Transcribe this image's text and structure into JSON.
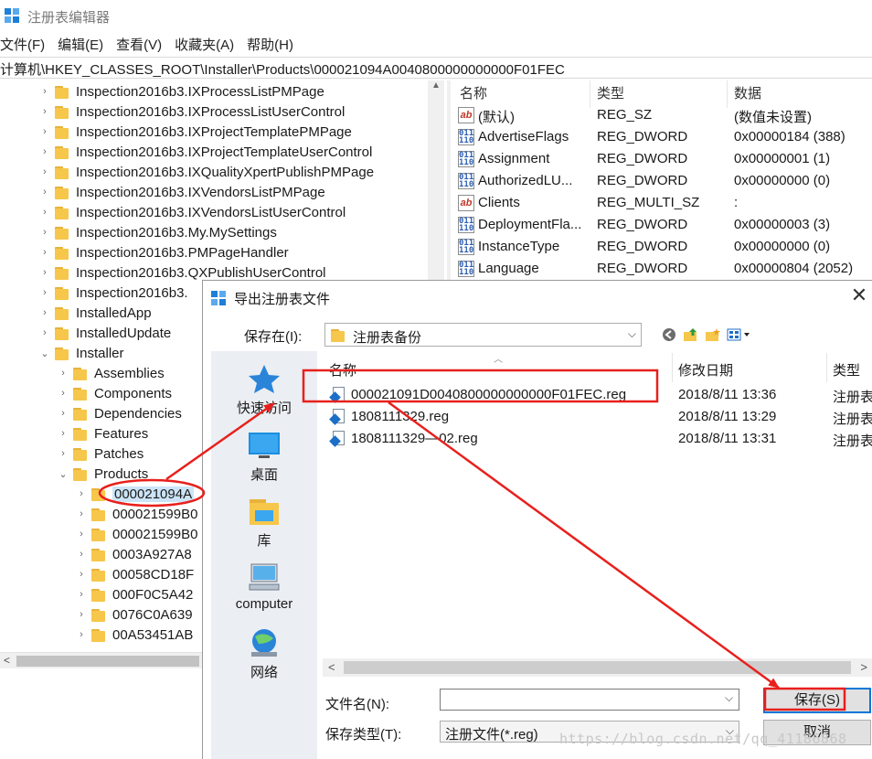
{
  "regedit": {
    "title": "注册表编辑器",
    "menu": [
      "文件(F)",
      "编辑(E)",
      "查看(V)",
      "收藏夹(A)",
      "帮助(H)"
    ],
    "address": "计算机\\HKEY_CLASSES_ROOT\\Installer\\Products\\000021094A0040800000000000F01FEC",
    "tree": [
      {
        "label": "Inspection2016b3.IXProcessListPMPage",
        "level": 1,
        "expanded": false
      },
      {
        "label": "Inspection2016b3.IXProcessListUserControl",
        "level": 1,
        "expanded": false
      },
      {
        "label": "Inspection2016b3.IXProjectTemplatePMPage",
        "level": 1,
        "expanded": false
      },
      {
        "label": "Inspection2016b3.IXProjectTemplateUserControl",
        "level": 1,
        "expanded": false
      },
      {
        "label": "Inspection2016b3.IXQualityXpertPublishPMPage",
        "level": 1,
        "expanded": false
      },
      {
        "label": "Inspection2016b3.IXVendorsListPMPage",
        "level": 1,
        "expanded": false
      },
      {
        "label": "Inspection2016b3.IXVendorsListUserControl",
        "level": 1,
        "expanded": false
      },
      {
        "label": "Inspection2016b3.My.MySettings",
        "level": 1,
        "expanded": false
      },
      {
        "label": "Inspection2016b3.PMPageHandler",
        "level": 1,
        "expanded": false
      },
      {
        "label": "Inspection2016b3.QXPublishUserControl",
        "level": 1,
        "expanded": false
      },
      {
        "label": "Inspection2016b3.",
        "level": 1,
        "expanded": false
      },
      {
        "label": "InstalledApp",
        "level": 1,
        "expanded": false
      },
      {
        "label": "InstalledUpdate",
        "level": 1,
        "expanded": false
      },
      {
        "label": "Installer",
        "level": 1,
        "expanded": true
      },
      {
        "label": "Assemblies",
        "level": 2,
        "expanded": false
      },
      {
        "label": "Components",
        "level": 2,
        "expanded": false
      },
      {
        "label": "Dependencies",
        "level": 2,
        "expanded": false
      },
      {
        "label": "Features",
        "level": 2,
        "expanded": false
      },
      {
        "label": "Patches",
        "level": 2,
        "expanded": false
      },
      {
        "label": "Products",
        "level": 2,
        "expanded": true
      },
      {
        "label": "000021094A",
        "level": 3,
        "expanded": false,
        "selected": true
      },
      {
        "label": "000021599B0",
        "level": 3,
        "expanded": false
      },
      {
        "label": "000021599B0",
        "level": 3,
        "expanded": false
      },
      {
        "label": "0003A927A8",
        "level": 3,
        "expanded": false
      },
      {
        "label": "00058CD18F",
        "level": 3,
        "expanded": false
      },
      {
        "label": "000F0C5A42",
        "level": 3,
        "expanded": false
      },
      {
        "label": "0076C0A639",
        "level": 3,
        "expanded": false
      },
      {
        "label": "00A53451AB",
        "level": 3,
        "expanded": false
      }
    ],
    "values_headers": {
      "name": "名称",
      "type": "类型",
      "data": "数据"
    },
    "values": [
      {
        "icon": "string-value-icon",
        "name": "(默认)",
        "type": "REG_SZ",
        "data": "(数值未设置)"
      },
      {
        "icon": "binary-value-icon",
        "name": "AdvertiseFlags",
        "type": "REG_DWORD",
        "data": "0x00000184 (388)"
      },
      {
        "icon": "binary-value-icon",
        "name": "Assignment",
        "type": "REG_DWORD",
        "data": "0x00000001 (1)"
      },
      {
        "icon": "binary-value-icon",
        "name": "AuthorizedLU...",
        "type": "REG_DWORD",
        "data": "0x00000000 (0)"
      },
      {
        "icon": "string-value-icon",
        "name": "Clients",
        "type": "REG_MULTI_SZ",
        "data": ":"
      },
      {
        "icon": "binary-value-icon",
        "name": "DeploymentFla...",
        "type": "REG_DWORD",
        "data": "0x00000003 (3)"
      },
      {
        "icon": "binary-value-icon",
        "name": "InstanceType",
        "type": "REG_DWORD",
        "data": "0x00000000 (0)"
      },
      {
        "icon": "binary-value-icon",
        "name": "Language",
        "type": "REG_DWORD",
        "data": "0x00000804 (2052)"
      }
    ]
  },
  "dialog": {
    "title": "导出注册表文件",
    "save_in_label": "保存在(I):",
    "save_in_value": "注册表备份",
    "places": [
      {
        "icon": "quick-access-icon",
        "label": "快速访问"
      },
      {
        "icon": "desktop-icon",
        "label": "桌面"
      },
      {
        "icon": "library-icon",
        "label": "库"
      },
      {
        "icon": "computer-icon",
        "label": "computer"
      },
      {
        "icon": "network-icon",
        "label": "网络"
      }
    ],
    "columns": {
      "name": "名称",
      "modified": "修改日期",
      "type": "类型"
    },
    "files": [
      {
        "name": "000021091D0040800000000000F01FEC.reg",
        "modified": "2018/8/11 13:36",
        "type": "注册表"
      },
      {
        "name": "1808111329.reg",
        "modified": "2018/8/11 13:29",
        "type": "注册表"
      },
      {
        "name": "1808111329—02.reg",
        "modified": "2018/8/11 13:31",
        "type": "注册表"
      }
    ],
    "filename_label": "文件名(N):",
    "filename_value": "",
    "filetype_label": "保存类型(T):",
    "filetype_value": "注册文件(*.reg)",
    "save_button": "保存(S)",
    "cancel_button": "取消"
  },
  "watermark": "https://blog.csdn.net/qq_41186868",
  "annotation_color": "#e8201c"
}
